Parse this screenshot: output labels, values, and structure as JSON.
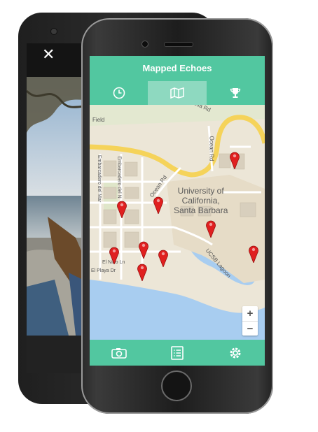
{
  "back_phone": {
    "close_label": "✕"
  },
  "app": {
    "title": "Mapped Echoes",
    "tabs": [
      {
        "icon": "clock-icon",
        "active": false
      },
      {
        "icon": "map-icon",
        "active": true
      },
      {
        "icon": "trophy-icon",
        "active": false
      }
    ],
    "bottom_nav": [
      {
        "icon": "camera-icon"
      },
      {
        "icon": "list-icon"
      },
      {
        "icon": "gear-icon"
      }
    ],
    "accent_color": "#52c7a0",
    "active_tab_color": "#8ed9c0",
    "pin_color": "#e02020"
  },
  "map": {
    "labels": {
      "field": "Field",
      "street_top": "esa Rd",
      "ocean_rd_right": "Ocean Rd",
      "ocean_rd_diag": "Ocean Rd",
      "embarcadero_mar": "Embarcadero del Mar",
      "embarcadero_norte": "Embarcadero del N",
      "nido": "El Nido Ln",
      "playa": "El Playa Dr",
      "lagoon": "UCSB Lagoon"
    },
    "campus_line1": "University of",
    "campus_line2": "California,",
    "campus_line3": "Santa Barbara",
    "zoom_in": "+",
    "zoom_out": "−",
    "pin_count": 10
  }
}
